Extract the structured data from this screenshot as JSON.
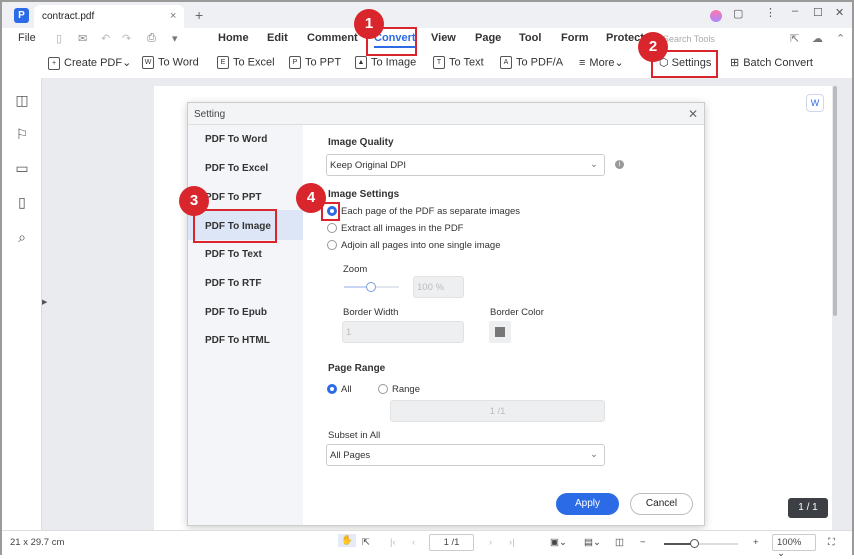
{
  "tab": {
    "title": "contract.pdf"
  },
  "menu": {
    "file": "File",
    "items": [
      "Home",
      "Edit",
      "Comment",
      "Convert",
      "View",
      "Page",
      "Tool",
      "Form",
      "Protect"
    ],
    "search_placeholder": "Search Tools"
  },
  "toolbar": {
    "items": [
      {
        "label": "Create PDF",
        "icon": "+"
      },
      {
        "label": "To Word",
        "icon": "W"
      },
      {
        "label": "To Excel",
        "icon": "E"
      },
      {
        "label": "To PPT",
        "icon": "P"
      },
      {
        "label": "To Image",
        "icon": "▲"
      },
      {
        "label": "To Text",
        "icon": "T"
      },
      {
        "label": "To PDF/A",
        "icon": "A"
      },
      {
        "label": "More",
        "icon": "≡"
      }
    ],
    "settings": "Settings",
    "batch": "Batch Convert"
  },
  "dialog": {
    "title": "Setting",
    "nav": [
      "PDF To Word",
      "PDF To Excel",
      "PDF To PPT",
      "PDF To Image",
      "PDF To Text",
      "PDF To RTF",
      "PDF To Epub",
      "PDF To HTML"
    ],
    "image_quality_label": "Image Quality",
    "image_quality_value": "Keep Original DPI",
    "image_settings_label": "Image Settings",
    "options": [
      "Each page of the PDF as separate images",
      "Extract all images in the PDF",
      "Adjoin all pages into one single image"
    ],
    "zoom_label": "Zoom",
    "zoom_value": "100 %",
    "zoom_fraction": 0.5,
    "border_width_label": "Border Width",
    "border_width_value": "1",
    "border_color_label": "Border Color",
    "border_color": "#777777",
    "page_range_label": "Page Range",
    "all": "All",
    "range": "Range",
    "range_value": "1 /1",
    "subset_label": "Subset in All",
    "subset_value": "All Pages",
    "apply": "Apply",
    "cancel": "Cancel"
  },
  "annotations": [
    "1",
    "2",
    "3",
    "4"
  ],
  "page_counter": "1 / 1",
  "status": {
    "size": "21 x 29.7 cm",
    "page": "1 /1",
    "zoom": "100%"
  },
  "colors": {
    "accent": "#2b6be6",
    "annotation": "#d9262c"
  }
}
